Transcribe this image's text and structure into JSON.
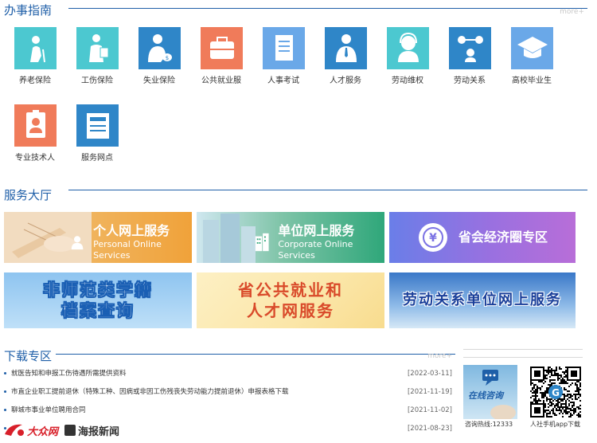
{
  "guide": {
    "title": "办事指南",
    "more": "more+",
    "items": [
      {
        "label": "养老保险",
        "color": "#4cc8d0",
        "icon": "elderly-person-icon"
      },
      {
        "label": "工伤保险",
        "color": "#4cc8d0",
        "icon": "injured-worker-icon"
      },
      {
        "label": "失业保险",
        "color": "#2f86c8",
        "icon": "unemployed-person-icon"
      },
      {
        "label": "公共就业服",
        "color": "#f07b5a",
        "icon": "briefcase-icon"
      },
      {
        "label": "人事考试",
        "color": "#6aa8e8",
        "icon": "exam-document-icon"
      },
      {
        "label": "人才服务",
        "color": "#2f86c8",
        "icon": "talent-person-icon"
      },
      {
        "label": "劳动维权",
        "color": "#4cc8d0",
        "icon": "labor-rights-icon"
      },
      {
        "label": "劳动关系",
        "color": "#2f86c8",
        "icon": "labor-relations-icon"
      },
      {
        "label": "高校毕业生",
        "color": "#6aa8e8",
        "icon": "graduation-cap-icon"
      },
      {
        "label": "专业技术人",
        "color": "#f07b5a",
        "icon": "id-badge-icon"
      },
      {
        "label": "服务网点",
        "color": "#2f86c8",
        "icon": "service-outlet-icon"
      }
    ]
  },
  "hall": {
    "title": "服务大厅",
    "banners": {
      "personal": {
        "cn": "个人网上服务",
        "en": "Personal Online Services"
      },
      "corporate": {
        "cn": "单位网上服务",
        "en": "Corporate Online Services"
      },
      "economic": {
        "cn": "省会经济圈专区"
      },
      "archive": {
        "line1": "非师范类学籍",
        "line2": "档案查询"
      },
      "employment": {
        "line1": "省公共就业和",
        "line2": "人才网服务"
      },
      "labor": {
        "cn": "劳动关系单位网上服务"
      }
    }
  },
  "downloads": {
    "title": "下载专区",
    "more": "more+",
    "items": [
      {
        "title": "就医告知和申报工伤待遇所需提供资料",
        "date": "[2022-03-11]"
      },
      {
        "title": "市直企业职工提前退休（特殊工种、因病或非因工伤残丧失劳动能力提前退休）申报表格下载",
        "date": "[2021-11-19]"
      },
      {
        "title": "聊城市事业单位聘用合同",
        "date": "[2021-11-02]"
      },
      {
        "title": "",
        "date": "[2021-08-23]"
      }
    ]
  },
  "sidebar": {
    "consult_label": "在线咨询",
    "hotline": "咨询热线:12333",
    "app_label": "人社手机app下载"
  },
  "watermark": {
    "brand1": "大众网",
    "brand2": "海报新闻"
  }
}
